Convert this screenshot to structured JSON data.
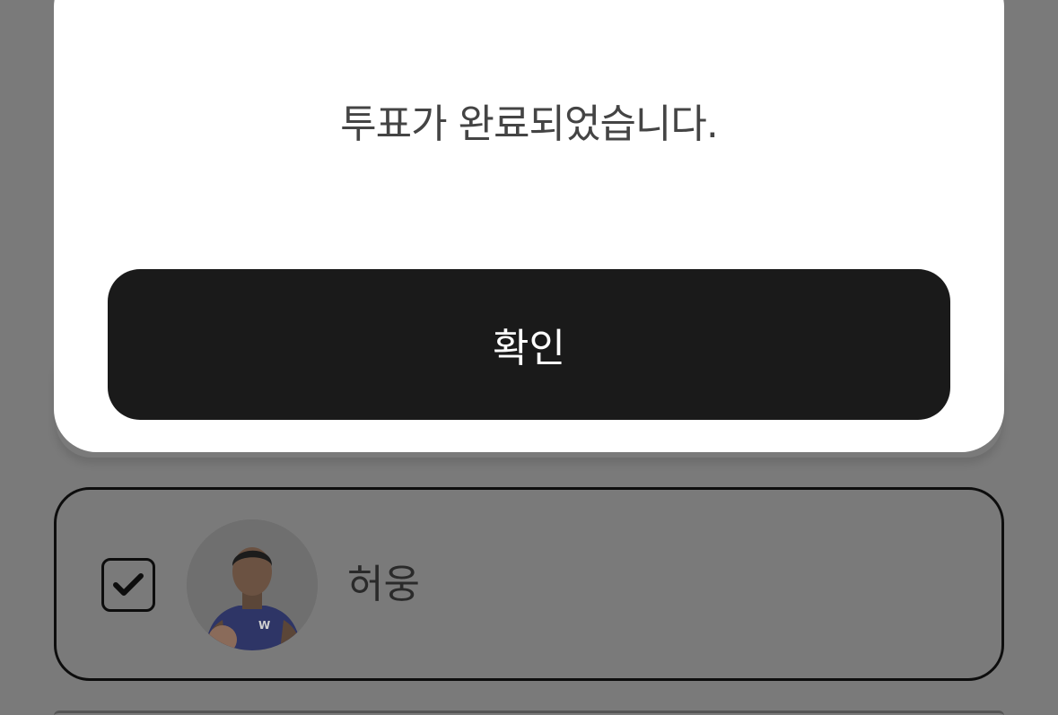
{
  "modal": {
    "message": "투표가 완료되었습니다.",
    "confirm_label": "확인"
  },
  "candidate": {
    "name": "허웅",
    "checked": true
  },
  "colors": {
    "overlay_bg": "#7a7a7a",
    "modal_bg": "#ffffff",
    "button_bg": "#1a1a1a",
    "button_text": "#ffffff",
    "jersey": "#2e3566"
  },
  "icons": {
    "checkbox": "check-icon"
  }
}
